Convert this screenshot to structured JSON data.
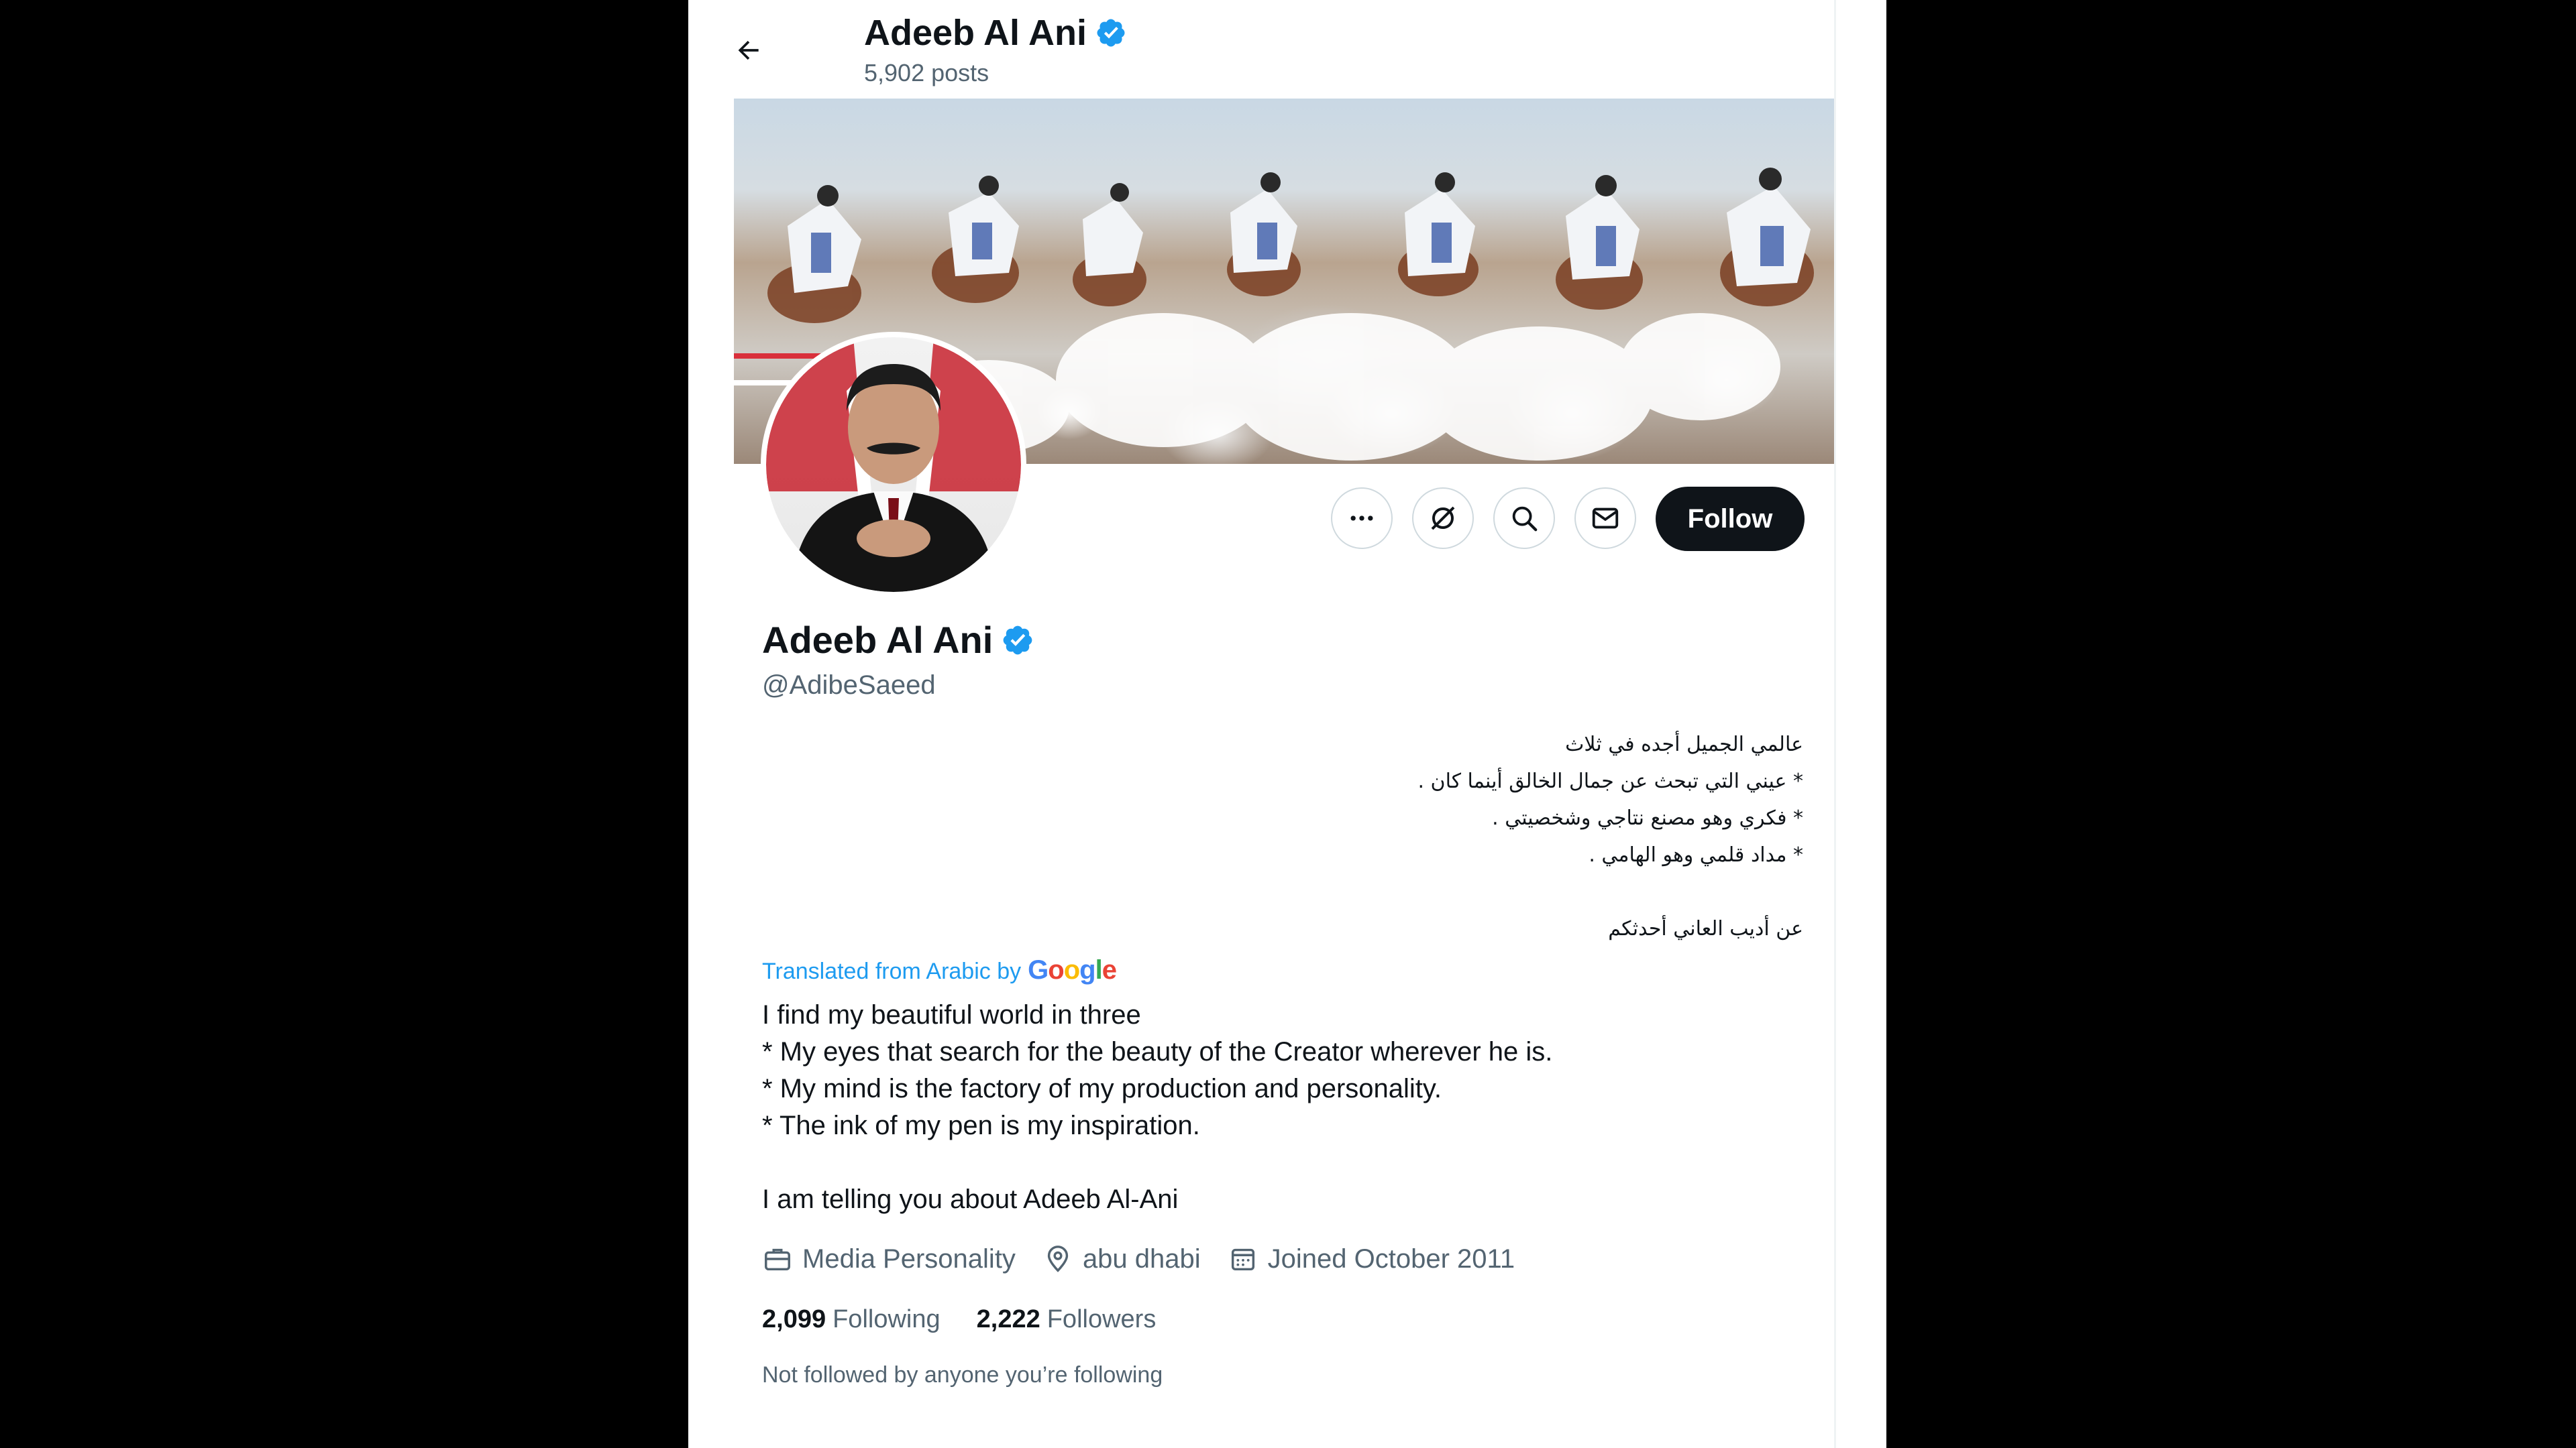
{
  "colors": {
    "accent": "#1d9bf0",
    "text_primary": "#0f1419",
    "text_secondary": "#536471",
    "follow_button_bg": "#0f1419",
    "border": "#cfd9de"
  },
  "header": {
    "back_icon": "arrow-left-icon",
    "name": "Adeeb Al Ani",
    "verified_icon": "verified-badge-icon",
    "posts_count": "5,902 posts"
  },
  "actions": {
    "more_icon": "more-dots-icon",
    "grok_icon": "grok-icon",
    "search_icon": "search-icon",
    "message_icon": "envelope-icon",
    "follow_label": "Follow"
  },
  "profile": {
    "name": "Adeeb Al Ani",
    "handle": "@AdibeSaeed",
    "bio_arabic": [
      "عالمي الجميل أجده في ثلاث",
      "* عيني  التي تبحث عن جمال الخالق أينما كان .",
      "* فكري  وهو مصنع  نتاجي وشخصيتي .",
      "* مداد قلمي  وهو الهامي .",
      "",
      "عن أديب  العاني أحدثكم"
    ],
    "translated_label": "Translated from Arabic by",
    "translator": "Google",
    "bio_english": [
      "I find my beautiful world in three",
      "* My eyes that search for the beauty of the Creator wherever he is.",
      "* My mind is the factory of my production and personality.",
      "* The ink of my pen is my inspiration.",
      "",
      "I am telling you about Adeeb Al-Ani"
    ],
    "category": "Media Personality",
    "location": "abu dhabi",
    "joined": "Joined October 2011",
    "following_count": "2,099",
    "following_label": "Following",
    "followers_count": "2,222",
    "followers_label": "Followers",
    "not_followed_text": "Not followed by anyone you’re following"
  }
}
